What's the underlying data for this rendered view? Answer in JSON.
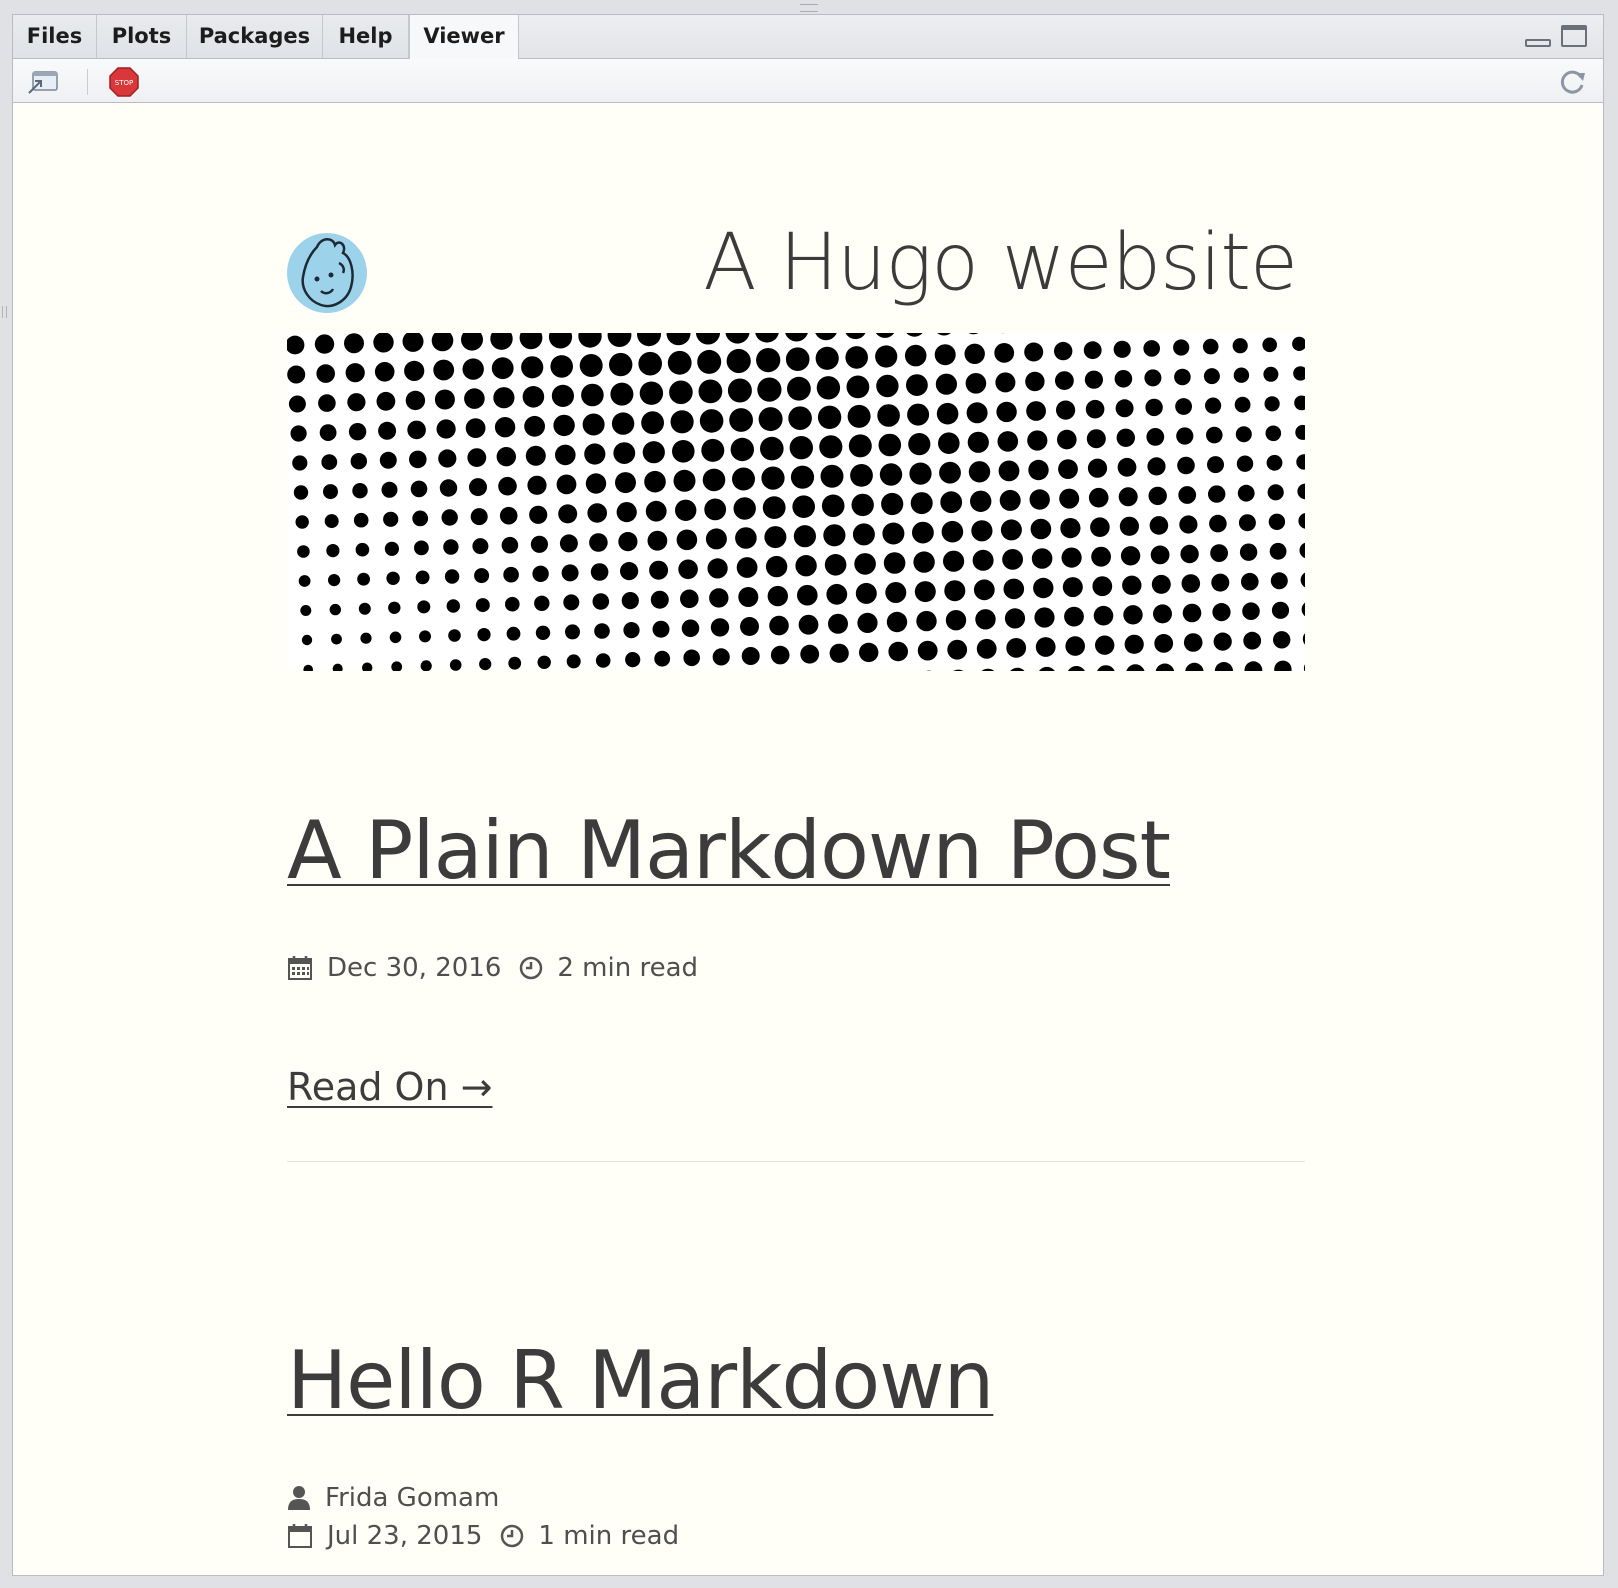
{
  "tabs": [
    {
      "label": "Files"
    },
    {
      "label": "Plots"
    },
    {
      "label": "Packages"
    },
    {
      "label": "Help"
    },
    {
      "label": "Viewer"
    }
  ],
  "active_tab": "Viewer",
  "toolbar": {
    "stop_icon_text": "STOP"
  },
  "site": {
    "title": "A Hugo website"
  },
  "posts": [
    {
      "title": "A Plain Markdown Post",
      "date": "Dec 30, 2016",
      "read_time": "2 min read",
      "read_on": "Read On →"
    },
    {
      "title": "Hello R Markdown",
      "author": "Frida Gomam",
      "date": "Jul 23, 2015",
      "read_time": "1 min read"
    }
  ],
  "colors": {
    "page_background": "#fffff8",
    "text": "#3d3d3d",
    "avatar_background": "#9dd3ea",
    "stop_red": "#d9383a"
  }
}
